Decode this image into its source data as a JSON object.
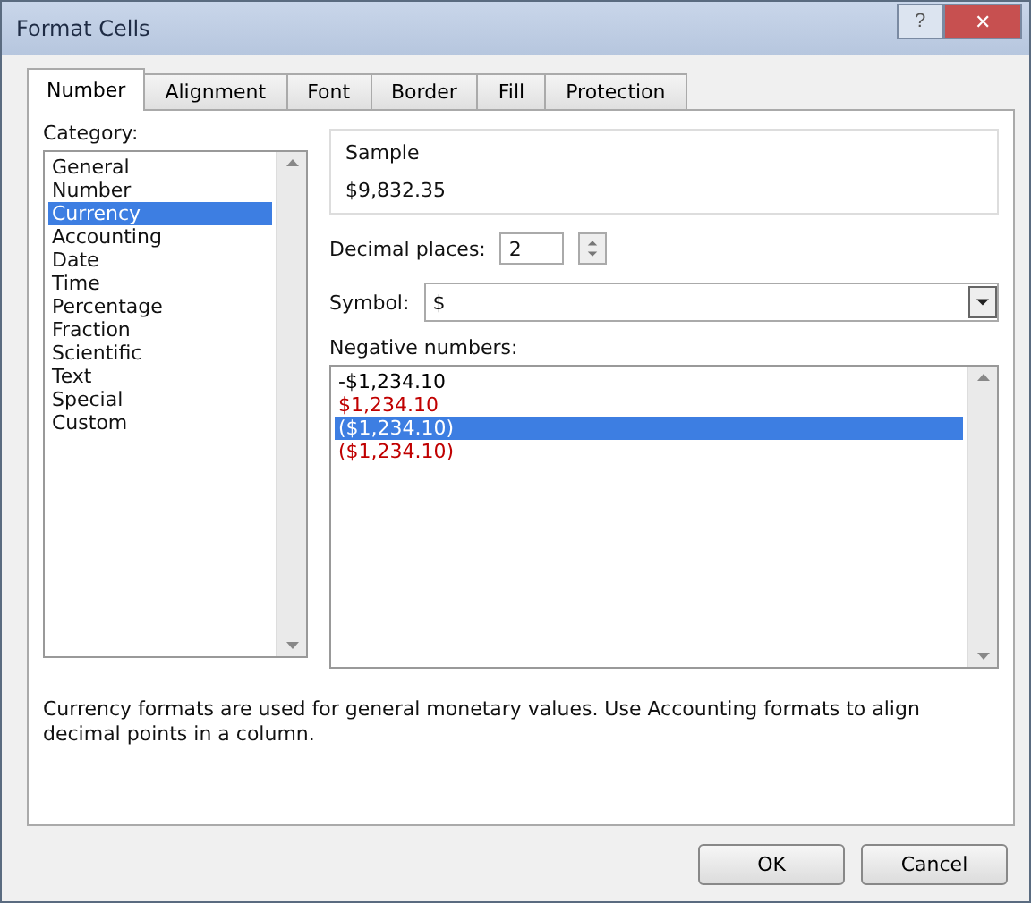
{
  "window": {
    "title": "Format Cells",
    "help_button": "?",
    "close_button": "✕"
  },
  "tabs": [
    {
      "label": "Number",
      "selected": true
    },
    {
      "label": "Alignment",
      "selected": false
    },
    {
      "label": "Font",
      "selected": false
    },
    {
      "label": "Border",
      "selected": false
    },
    {
      "label": "Fill",
      "selected": false
    },
    {
      "label": "Protection",
      "selected": false
    }
  ],
  "category": {
    "label": "Category:",
    "items": [
      {
        "label": "General",
        "selected": false
      },
      {
        "label": "Number",
        "selected": false
      },
      {
        "label": "Currency",
        "selected": true
      },
      {
        "label": "Accounting",
        "selected": false
      },
      {
        "label": "Date",
        "selected": false
      },
      {
        "label": "Time",
        "selected": false
      },
      {
        "label": "Percentage",
        "selected": false
      },
      {
        "label": "Fraction",
        "selected": false
      },
      {
        "label": "Scientific",
        "selected": false
      },
      {
        "label": "Text",
        "selected": false
      },
      {
        "label": "Special",
        "selected": false
      },
      {
        "label": "Custom",
        "selected": false
      }
    ]
  },
  "sample": {
    "label": "Sample",
    "value": "$9,832.35"
  },
  "decimal_places": {
    "label": "Decimal places:",
    "value": "2"
  },
  "symbol": {
    "label": "Symbol:",
    "value": "$"
  },
  "negative_numbers": {
    "label": "Negative numbers:",
    "items": [
      {
        "label": "-$1,234.10",
        "color": "#000000",
        "selected": false
      },
      {
        "label": "$1,234.10",
        "color": "#c00000",
        "selected": false
      },
      {
        "label": "($1,234.10)",
        "selected": true
      },
      {
        "label": "($1,234.10)",
        "color": "#c00000",
        "selected": false
      }
    ]
  },
  "description": "Currency formats are used for general monetary values.  Use Accounting formats to align decimal points in a column.",
  "buttons": [
    "OK",
    "Cancel"
  ]
}
